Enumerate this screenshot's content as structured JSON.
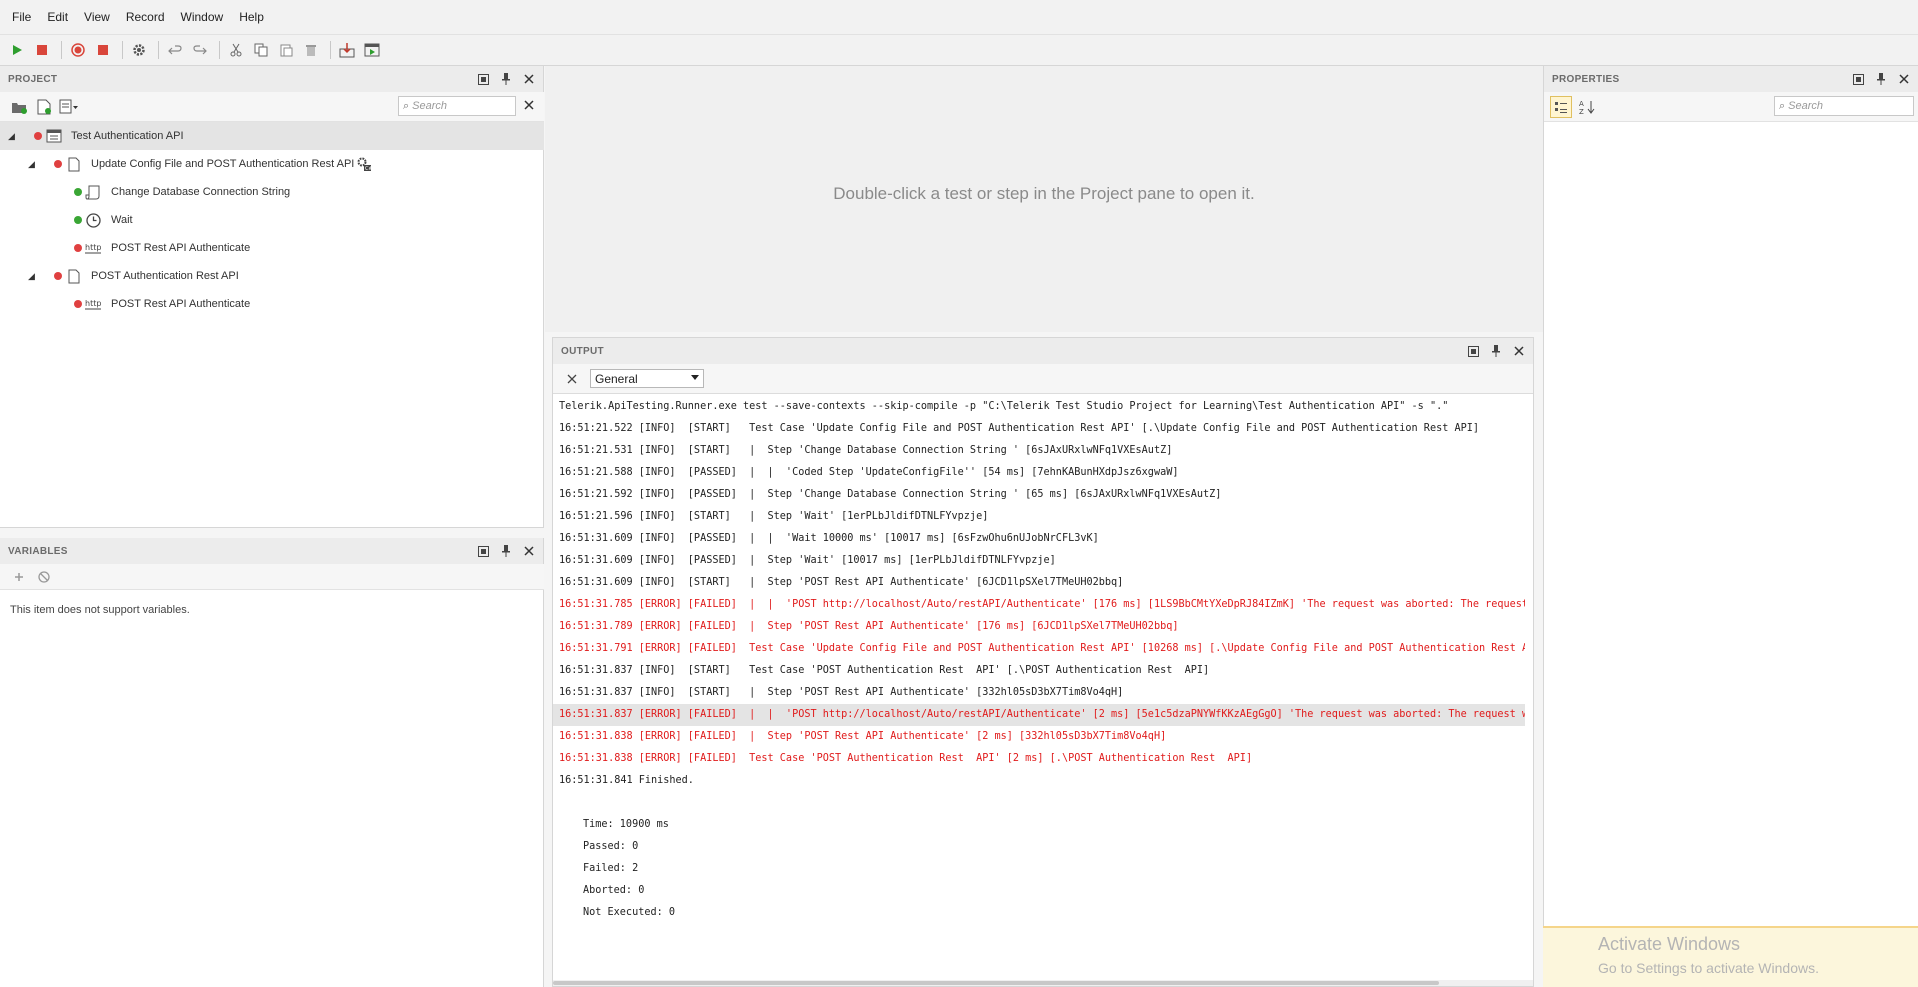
{
  "menu": [
    "File",
    "Edit",
    "View",
    "Record",
    "Window",
    "Help"
  ],
  "project": {
    "title": "PROJECT",
    "search_placeholder": "Search",
    "tree": {
      "root": "Test Authentication API",
      "test1": "Update Config File and POST Authentication Rest API",
      "test1_steps": [
        "Change Database Connection String",
        "Wait",
        "POST Rest API Authenticate"
      ],
      "test2": "POST Authentication Rest  API",
      "test2_steps": [
        "POST Rest API Authenticate"
      ]
    }
  },
  "variables": {
    "title": "VARIABLES",
    "message": "This item does not support variables."
  },
  "center": {
    "message": "Double-click a test or step in the Project pane to open it."
  },
  "output": {
    "title": "OUTPUT",
    "filter": "General",
    "lines": [
      "Telerik.ApiTesting.Runner.exe test --save-contexts --skip-compile -p \"C:\\Telerik Test Studio Project for Learning\\Test Authentication API\" -s \".\"",
      "16:51:21.522 [INFO]  [START]   Test Case 'Update Config File and POST Authentication Rest API' [.\\Update Config File and POST Authentication Rest API]",
      "16:51:21.531 [INFO]  [START]   |  Step 'Change Database Connection String ' [6sJAxURxlwNFq1VXEsAutZ]",
      "16:51:21.588 [INFO]  [PASSED]  |  |  'Coded Step 'UpdateConfigFile'' [54 ms] [7ehnKABunHXdpJsz6xgwaW]",
      "16:51:21.592 [INFO]  [PASSED]  |  Step 'Change Database Connection String ' [65 ms] [6sJAxURxlwNFq1VXEsAutZ]",
      "16:51:21.596 [INFO]  [START]   |  Step 'Wait' [1erPLbJldifDTNLFYvpzje]",
      "16:51:31.609 [INFO]  [PASSED]  |  |  'Wait 10000 ms' [10017 ms] [6sFzwOhu6nUJobNrCFL3vK]",
      "16:51:31.609 [INFO]  [PASSED]  |  Step 'Wait' [10017 ms] [1erPLbJldifDTNLFYvpzje]",
      "16:51:31.609 [INFO]  [START]   |  Step 'POST Rest API Authenticate' [6JCD1lpSXel7TMeUH02bbq]",
      "16:51:31.785 [ERROR] [FAILED]  |  |  'POST http://localhost/Auto/restAPI/Authenticate' [176 ms] [1LS9BbCMtYXeDpRJ84IZmK] 'The request was aborted: The request was canceled.'",
      "16:51:31.789 [ERROR] [FAILED]  |  Step 'POST Rest API Authenticate' [176 ms] [6JCD1lpSXel7TMeUH02bbq]",
      "16:51:31.791 [ERROR] [FAILED]  Test Case 'Update Config File and POST Authentication Rest API' [10268 ms] [.\\Update Config File and POST Authentication Rest API]",
      "16:51:31.837 [INFO]  [START]   Test Case 'POST Authentication Rest  API' [.\\POST Authentication Rest  API]",
      "16:51:31.837 [INFO]  [START]   |  Step 'POST Rest API Authenticate' [332hl05sD3bX7Tim8Vo4qH]",
      "16:51:31.837 [ERROR] [FAILED]  |  |  'POST http://localhost/Auto/restAPI/Authenticate' [2 ms] [5e1c5dzaPNYWfKKzAEgGgO] 'The request was aborted: The request was canceled.'",
      "16:51:31.838 [ERROR] [FAILED]  |  Step 'POST Rest API Authenticate' [2 ms] [332hl05sD3bX7Tim8Vo4qH]",
      "16:51:31.838 [ERROR] [FAILED]  Test Case 'POST Authentication Rest  API' [2 ms] [.\\POST Authentication Rest  API]",
      "16:51:31.841 Finished."
    ],
    "summary": [
      "Time: 10900 ms",
      "Passed: 0",
      "Failed: 2",
      "Aborted: 0",
      "Not Executed: 0"
    ]
  },
  "properties": {
    "title": "PROPERTIES",
    "search_placeholder": "Search"
  },
  "watermark": {
    "title": "Activate Windows",
    "subtitle": "Go to Settings to activate Windows."
  },
  "colors": {
    "error": "#e01b1b",
    "passed_dot": "#3aa635",
    "failed_dot": "#e04040",
    "run_green": "#2e9e2e",
    "stop_red": "#d9463b"
  }
}
